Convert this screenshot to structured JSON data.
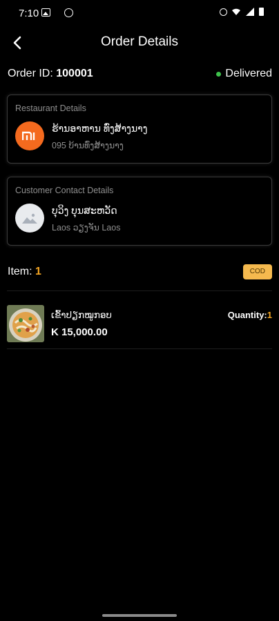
{
  "status_bar": {
    "time": "7:10"
  },
  "header": {
    "title": "Order Details"
  },
  "order": {
    "id_label": "Order ID:",
    "id_value": "100001",
    "status": "Delivered",
    "status_color": "#3ec24c"
  },
  "restaurant": {
    "section_title": "Restaurant Details",
    "name": "ຮ້ານອາຫານ ທົ່ງສ້າງນາງ",
    "address": "095 ບ້ານທົ່ງສ້າງນາງ",
    "logo_icon": "xiaomi-mi-logo",
    "logo_color": "#f46a1e"
  },
  "customer": {
    "section_title": "Customer Contact Details",
    "name": "ບຸວິງ ບຸນສະຫວັດ",
    "address": "Laos ວຽງຈັນ  Laos",
    "avatar_icon": "image-placeholder-icon"
  },
  "items": {
    "label": "Item: ",
    "count": "1",
    "payment_badge": "COD",
    "accent_color": "#f5a623"
  },
  "products": [
    {
      "name": "ເຂົ້າປຽກໝູກອບ",
      "price": "K 15,000.00",
      "quantity_label": "Quantity:",
      "quantity_value": "1"
    }
  ]
}
